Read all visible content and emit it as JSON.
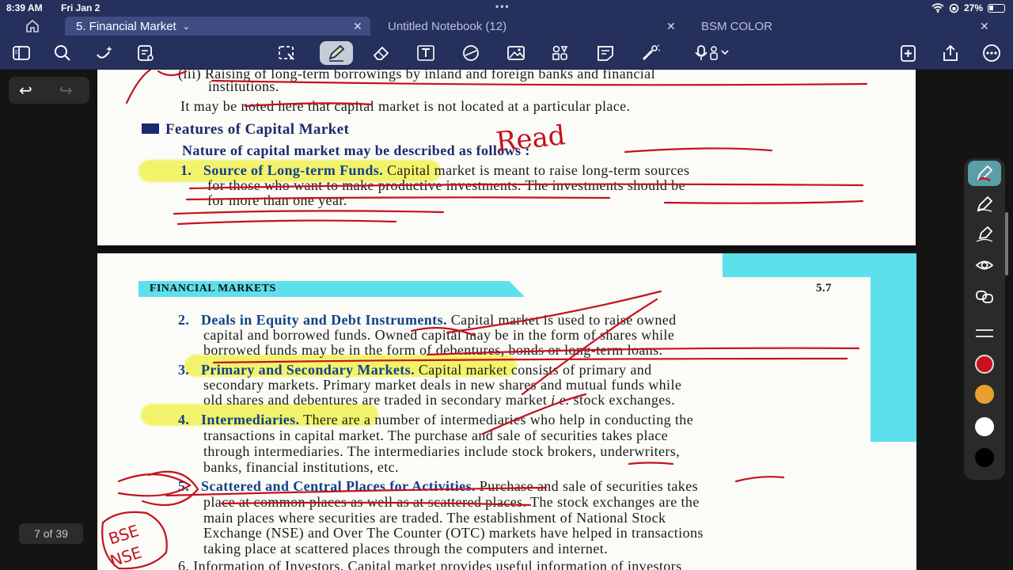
{
  "status": {
    "time": "8:39 AM",
    "date": "Fri Jan 2",
    "battery": "27%"
  },
  "tabs": [
    {
      "label": "5. Financial Market",
      "active": true
    },
    {
      "label": "Untitled Notebook (12)",
      "active": false
    },
    {
      "label": "BSM COLOR",
      "active": false
    }
  ],
  "toolbar_icons": [
    "sidebar-icon",
    "search-icon",
    "magic-icon",
    "document-icon",
    "lasso-icon",
    "pen-icon",
    "eraser-icon",
    "text-icon",
    "shapes-icon",
    "image-icon",
    "elements-icon",
    "sticky-note-icon",
    "laser-icon",
    "microphone-icon",
    "add-page-icon",
    "share-icon",
    "more-icon"
  ],
  "page_indicator": "7 of 39",
  "palette": {
    "tools": [
      "pen-tool",
      "pen-tool",
      "pen-tool",
      "eye-tool",
      "link-tool"
    ],
    "colors": [
      "#c8101e",
      "#e8a12c",
      "#ffffff",
      "#000000"
    ]
  },
  "page1": {
    "line1": "(iii) Raising of long-term borrowings by inland and foreign banks and financial",
    "line2": "institutions.",
    "line3": "It may be noted here that capital market is not located at a particular place.",
    "heading": "Features of Capital Market",
    "intro": "Nature of capital market may be described as follows :",
    "item1_num": "1.",
    "item1_title": "Source of Long-term Funds.",
    "item1_text": "Capital market is meant to raise long-term sources",
    "item1_line2": "for those who want to make productive investments. The investments should be",
    "item1_line3": "for more than one year."
  },
  "page2": {
    "header": "FINANCIAL MARKETS",
    "page_no": "5.7",
    "i2_num": "2.",
    "i2_title": "Deals in Equity and Debt Instruments.",
    "i2_text": "Capital market is used to raise owned",
    "i2_l2": "capital and borrowed funds. Owned capital may be in the form of shares while",
    "i2_l3": "borrowed funds may be in the form of debentures, bonds or long-term loans.",
    "i3_num": "3.",
    "i3_title": "Primary and Secondary Markets.",
    "i3_text": "Capital market consists of primary and",
    "i3_l2": "secondary markets. Primary market deals in new shares and mutual funds while",
    "i3_l3a": "old shares and debentures are traded in secondary market ",
    "i3_l3b": "i.e.",
    "i3_l3c": " stock exchanges.",
    "i4_num": "4.",
    "i4_title": "Intermediaries.",
    "i4_text": "There are a number of intermediaries who help in conducting the",
    "i4_l2": "transactions in capital market. The purchase and sale of securities takes place",
    "i4_l3": "through intermediaries. The intermediaries include stock brokers, underwriters,",
    "i4_l4": "banks, financial institutions, etc.",
    "i5_num": "5.",
    "i5_title": "Scattered and Central Places for Activities.",
    "i5_text": "Purchase and sale of securities takes",
    "i5_l2": "place at common places as well as at scattered places. The stock exchanges are the",
    "i5_l3": "main places where securities are traded. The establishment of National Stock",
    "i5_l4": "Exchange (NSE) and Over The Counter (OTC) markets have helped in transactions",
    "i5_l5": "taking place at scattered places through the computers and internet.",
    "i6_partial": "6.  Information of Investors. Capital market provides useful information of investors"
  },
  "annotations": {
    "read_note": "Read",
    "bse": "BSE",
    "nse": "NSE"
  }
}
